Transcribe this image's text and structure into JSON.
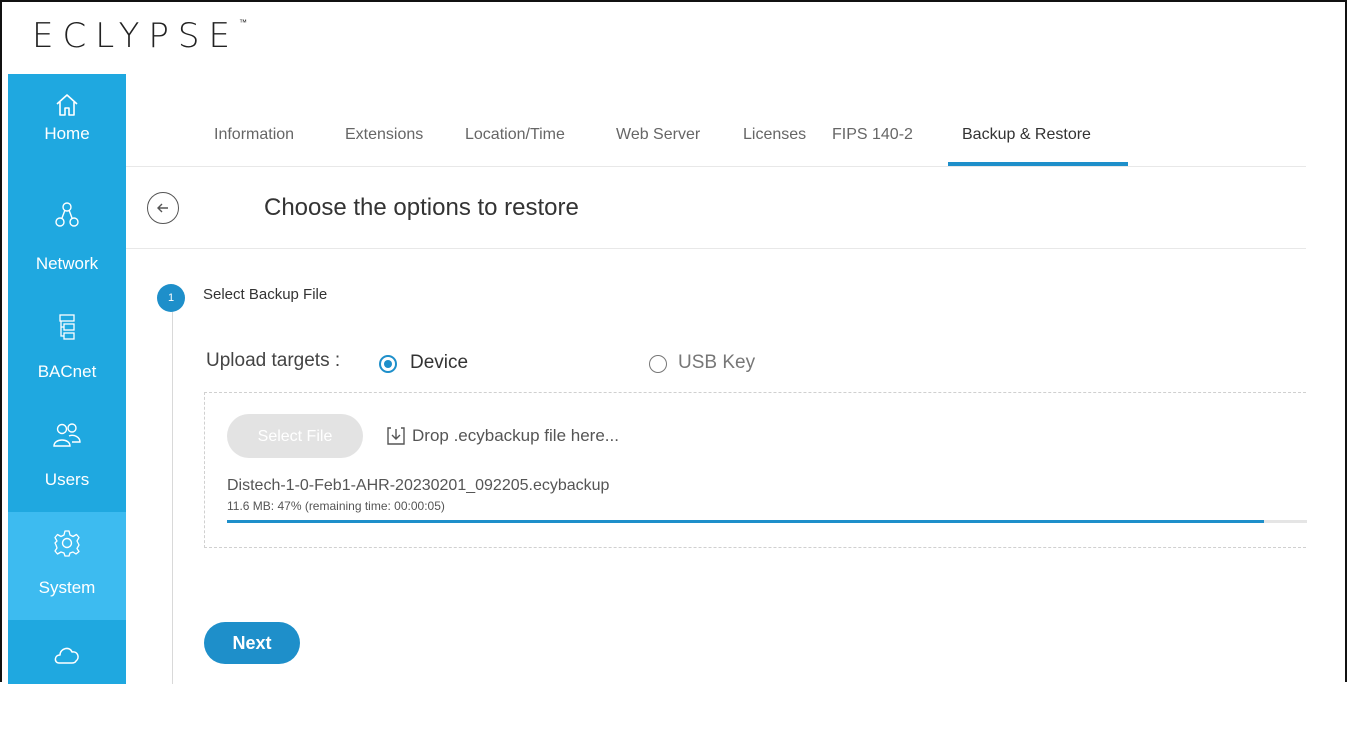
{
  "app": {
    "logo_text": "ECLYPSE",
    "logo_mark": "™"
  },
  "sidebar": {
    "items": [
      {
        "label": "Home",
        "icon": "home-icon"
      },
      {
        "label": "Network",
        "icon": "network-icon"
      },
      {
        "label": "BACnet",
        "icon": "bacnet-tree-icon"
      },
      {
        "label": "Users",
        "icon": "users-icon"
      },
      {
        "label": "System",
        "icon": "gear-icon",
        "active": true
      },
      {
        "label": "",
        "icon": "cloud-icon"
      }
    ]
  },
  "tabs": [
    {
      "label": "Information"
    },
    {
      "label": "Extensions"
    },
    {
      "label": "Location/Time"
    },
    {
      "label": "Web Server"
    },
    {
      "label": "Licenses"
    },
    {
      "label": "FIPS 140-2"
    },
    {
      "label": "Backup & Restore",
      "active": true
    }
  ],
  "header": {
    "title": "Choose the options to restore"
  },
  "step": {
    "number": "1",
    "label": "Select Backup File"
  },
  "upload": {
    "label": "Upload targets :",
    "options": [
      {
        "label": "Device",
        "selected": true
      },
      {
        "label": "USB Key",
        "selected": false
      }
    ]
  },
  "dropzone": {
    "select_button": "Select File",
    "drop_text": "Drop .ecybackup file here...",
    "file_name": "Distech-1-0-Feb1-AHR-20230201_092205.ecybackup",
    "file_meta": "11.6 MB: 47% (remaining time: 00:00:05)",
    "progress_fraction": 0.96
  },
  "actions": {
    "next_label": "Next"
  },
  "colors": {
    "sidebar_bg": "#1fa8e0",
    "sidebar_active": "#3dbbf0",
    "accent": "#1e8fca"
  }
}
